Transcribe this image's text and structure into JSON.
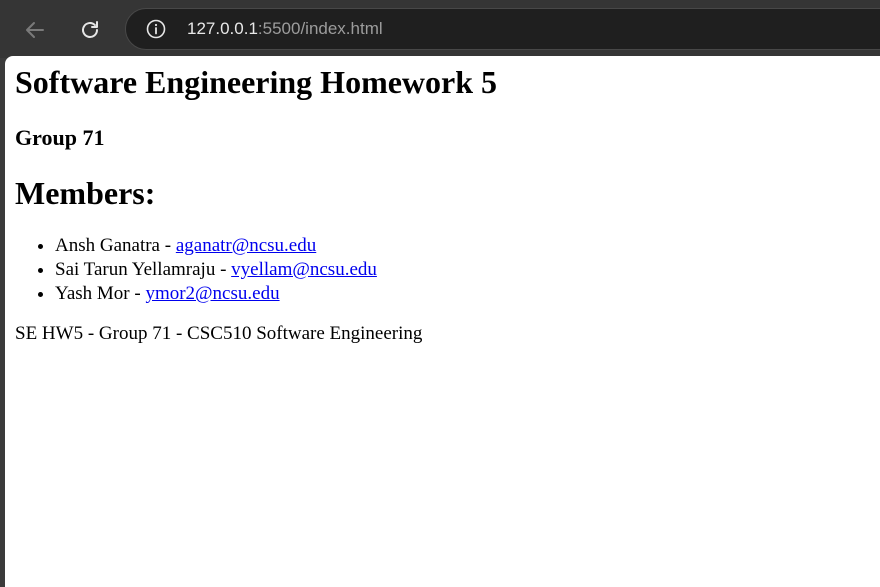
{
  "browser": {
    "url_host": "127.0.0.1",
    "url_path": ":5500/index.html"
  },
  "page": {
    "title": "Software Engineering Homework 5",
    "group": "Group 71",
    "members_heading": "Members:",
    "members": [
      {
        "name": "Ansh Ganatra",
        "separator": " - ",
        "email": "aganatr@ncsu.edu"
      },
      {
        "name": "Sai Tarun Yellamraju",
        "separator": " - ",
        "email": "vyellam@ncsu.edu"
      },
      {
        "name": "Yash Mor",
        "separator": " - ",
        "email": "ymor2@ncsu.edu"
      }
    ],
    "footer": "SE HW5 - Group 71 - CSC510 Software Engineering"
  },
  "colors": {
    "link": "#0000ee",
    "chrome_bg": "#353535",
    "omnibox_bg": "#1f1f1f"
  }
}
